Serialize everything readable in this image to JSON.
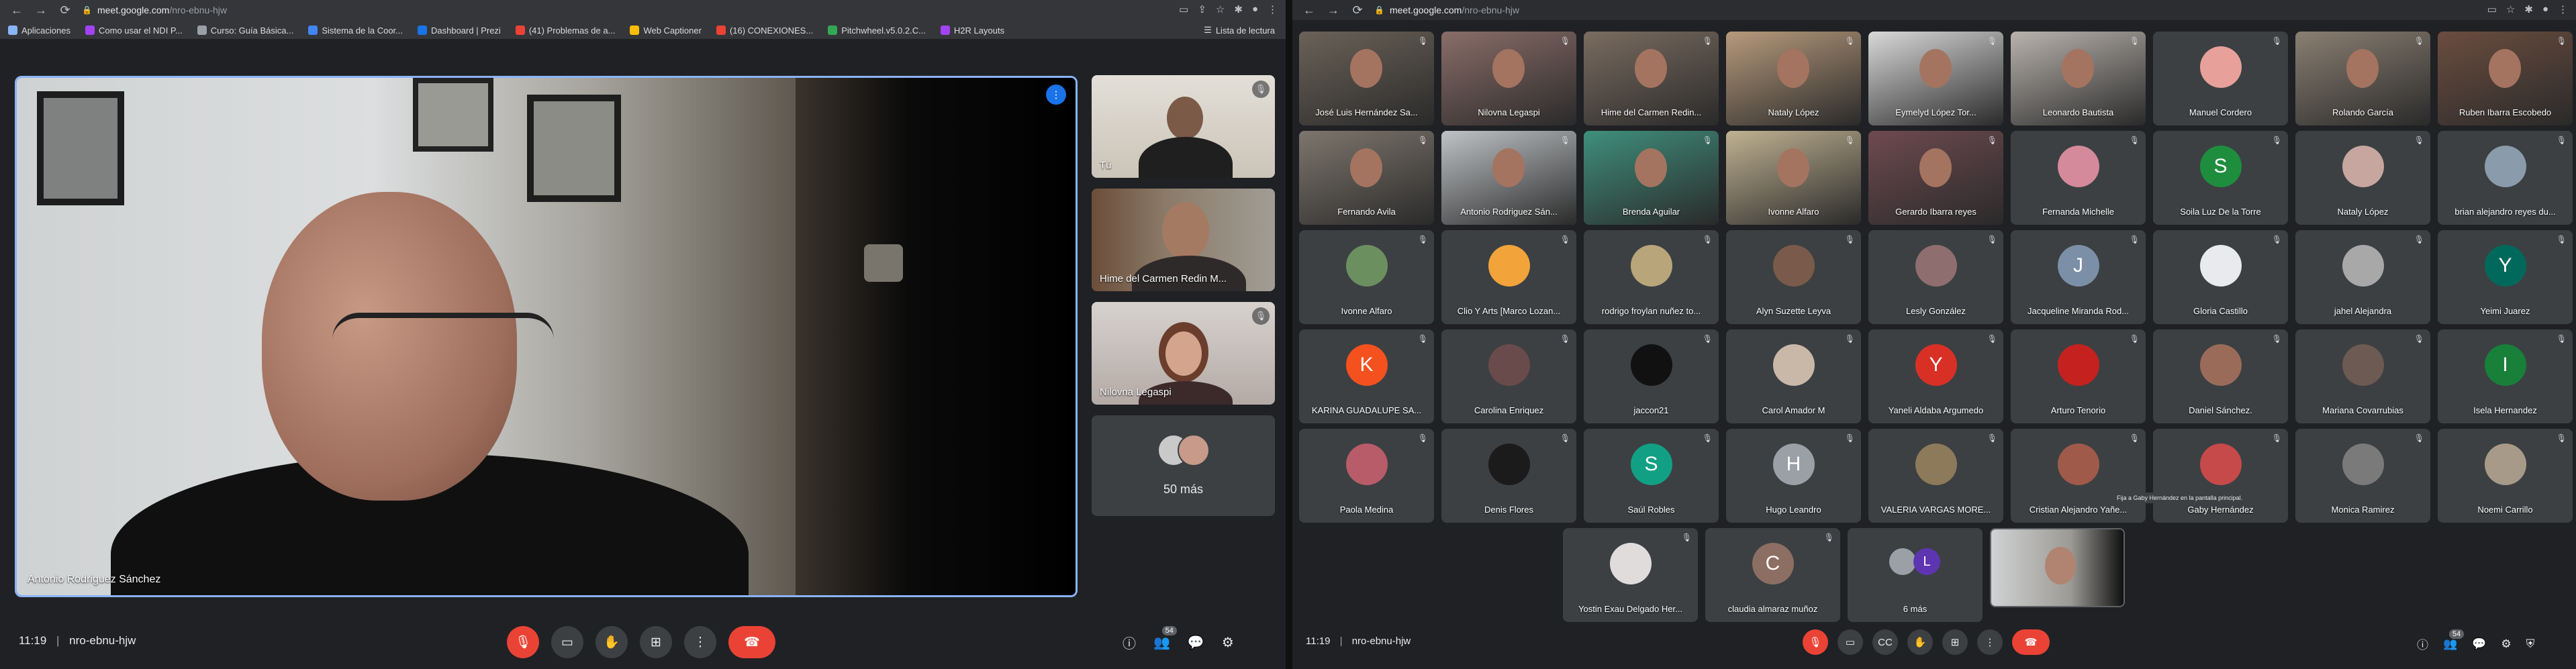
{
  "windowA": {
    "url_host": "meet.google.com",
    "url_path": "/nro-ebnu-hjw",
    "bookmarks": [
      {
        "label": "Aplicaciones",
        "color": "#8ab4f8"
      },
      {
        "label": "Como usar el NDI P...",
        "color": "#a142f4"
      },
      {
        "label": "Curso: Guía Básica...",
        "color": "#9aa0a6"
      },
      {
        "label": "Sistema de la Coor...",
        "color": "#4285f4"
      },
      {
        "label": "Dashboard | Prezi",
        "color": "#1a73e8"
      },
      {
        "label": "(41) Problemas de a...",
        "color": "#ea4335"
      },
      {
        "label": "Web Captioner",
        "color": "#fbbc04"
      },
      {
        "label": "(16) CONEXIONES...",
        "color": "#ea4335"
      },
      {
        "label": "Pitchwheel.v5.0.2.C...",
        "color": "#34a853"
      },
      {
        "label": "H2R Layouts",
        "color": "#a142f4"
      }
    ],
    "reading_list": "Lista de lectura",
    "main_speaker": "Antonio Rodriguez Sánchez",
    "side_tiles": [
      {
        "name": "Tú"
      },
      {
        "name": "Hime del Carmen Redin M..."
      },
      {
        "name": "Nilovna Legaspi"
      }
    ],
    "more_label": "50 más",
    "clock": "11:19",
    "meeting_code": "nro-ebnu-hjw",
    "participant_count": "54"
  },
  "windowB": {
    "url_host": "meet.google.com",
    "url_path": "/nro-ebnu-hjw",
    "clock": "11:19",
    "meeting_code": "nro-ebnu-hjw",
    "participant_count": "54",
    "tooltip": "Fija a Gaby Hernández en la pantalla principal.",
    "grid": [
      {
        "name": "José Luis Hernández Sa...",
        "type": "video",
        "bg": "#6b6258"
      },
      {
        "name": "Nilovna Legaspi",
        "type": "video",
        "bg": "#8a6d68"
      },
      {
        "name": "Hime del Carmen Redin...",
        "type": "video",
        "bg": "#7a6c60"
      },
      {
        "name": "Nataly López",
        "type": "video",
        "bg": "#b79a7c"
      },
      {
        "name": "Eymelyd López Tor...",
        "type": "video",
        "bg": "#d9d9d9"
      },
      {
        "name": "Leonardo Bautista",
        "type": "video",
        "bg": "#b9b3ad"
      },
      {
        "name": "Manuel Cordero",
        "type": "avatar",
        "bg": "#e8a09a",
        "letter": ""
      },
      {
        "name": "Rolando García",
        "type": "video",
        "bg": "#8a7f72"
      },
      {
        "name": "Ruben Ibarra Escobedo",
        "type": "video",
        "bg": "#6b4d3f"
      },
      {
        "name": "Fernando Avila",
        "type": "video",
        "bg": "#7e766d"
      },
      {
        "name": "Antonio Rodriguez Sán...",
        "type": "video",
        "bg": "#bfc3c6",
        "active": true
      },
      {
        "name": "Brenda Aguilar",
        "type": "video",
        "bg": "#3f8f7c"
      },
      {
        "name": "Ivonne Alfaro",
        "type": "video",
        "bg": "#c0b292"
      },
      {
        "name": "Gerardo Ibarra reyes",
        "type": "video",
        "bg": "#6e4a50"
      },
      {
        "name": "Fernanda Michelle",
        "type": "avatar",
        "bg": "#d48a9a",
        "letter": ""
      },
      {
        "name": "Soila Luz De la Torre",
        "type": "avatar",
        "bg": "#1e8e3e",
        "letter": "S"
      },
      {
        "name": "Nataly López",
        "type": "avatar",
        "bg": "#c7a6a0",
        "letter": ""
      },
      {
        "name": "brian alejandro reyes du...",
        "type": "avatar",
        "bg": "#8a9bab",
        "letter": ""
      },
      {
        "name": "Ivonne Alfaro",
        "type": "avatar",
        "bg": "#6c8f5f",
        "letter": ""
      },
      {
        "name": "Clio Y Arts [Marco Lozan...",
        "type": "avatar",
        "bg": "#f2a33a",
        "letter": ""
      },
      {
        "name": "rodrigo froylan nuñez to...",
        "type": "avatar",
        "bg": "#b9a57a",
        "letter": ""
      },
      {
        "name": "Alyn Suzette Leyva",
        "type": "avatar",
        "bg": "#7a5a4a",
        "letter": ""
      },
      {
        "name": "Lesly González",
        "type": "avatar",
        "bg": "#8e6e6e",
        "letter": ""
      },
      {
        "name": "Jacqueline Miranda Rod...",
        "type": "avatar",
        "bg": "#7b8fa6",
        "letter": "J"
      },
      {
        "name": "Gloria Castillo",
        "type": "avatar",
        "bg": "#e8eaed",
        "letter": ""
      },
      {
        "name": "jahel Alejandra",
        "type": "avatar",
        "bg": "#a8a8a8",
        "letter": ""
      },
      {
        "name": "Yeimi Juarez",
        "type": "avatar",
        "bg": "#00695c",
        "letter": "Y"
      },
      {
        "name": "KARINA GUADALUPE SA...",
        "type": "avatar",
        "bg": "#f4511e",
        "letter": "K"
      },
      {
        "name": "Carolina Enriquez",
        "type": "avatar",
        "bg": "#6a4b4b",
        "letter": ""
      },
      {
        "name": "jaccon21",
        "type": "avatar",
        "bg": "#111111",
        "letter": ""
      },
      {
        "name": "Carol Amador M",
        "type": "avatar",
        "bg": "#c9b8a8",
        "letter": ""
      },
      {
        "name": "Yaneli Aldaba Argumedo",
        "type": "avatar",
        "bg": "#d93025",
        "letter": "Y"
      },
      {
        "name": "Arturo Tenorio",
        "type": "avatar",
        "bg": "#c5221f",
        "letter": ""
      },
      {
        "name": "Daniel Sánchez.",
        "type": "avatar",
        "bg": "#9b6b5a",
        "letter": ""
      },
      {
        "name": "Mariana Covarrubias",
        "type": "avatar",
        "bg": "#6d5a52",
        "letter": ""
      },
      {
        "name": "Isela Hernandez",
        "type": "avatar",
        "bg": "#188038",
        "letter": "I"
      },
      {
        "name": "Paola Medina",
        "type": "avatar",
        "bg": "#b85c6a",
        "letter": ""
      },
      {
        "name": "Denis Flores",
        "type": "avatar",
        "bg": "#1b1b1b",
        "letter": ""
      },
      {
        "name": "Saúl Robles",
        "type": "avatar",
        "bg": "#12a085",
        "letter": "S"
      },
      {
        "name": "Hugo Leandro",
        "type": "avatar",
        "bg": "#9aa0a6",
        "letter": "H"
      },
      {
        "name": "VALERIA VARGAS MORE...",
        "type": "avatar",
        "bg": "#8d7a5a",
        "letter": ""
      },
      {
        "name": "Cristian Alejandro Yañe...",
        "type": "avatar",
        "bg": "#a05a4a",
        "letter": ""
      },
      {
        "name": "Gaby Hernández",
        "type": "avatar",
        "bg": "#c64a4a",
        "letter": ""
      },
      {
        "name": "Monica Ramirez",
        "type": "avatar",
        "bg": "#7a7a7a",
        "letter": ""
      },
      {
        "name": "Noemi Carrillo",
        "type": "avatar",
        "bg": "#a89a88",
        "letter": ""
      }
    ],
    "last_row": [
      {
        "name": "Yostin Exau Delgado Her...",
        "type": "avatar",
        "bg": "#e0dcdc",
        "letter": ""
      },
      {
        "name": "claudia almaraz muñoz",
        "type": "avatar",
        "bg": "#8d6e63",
        "letter": "C"
      },
      {
        "name": "6 más",
        "type": "more",
        "bg": "#5e35b1",
        "letter": "L"
      }
    ]
  }
}
